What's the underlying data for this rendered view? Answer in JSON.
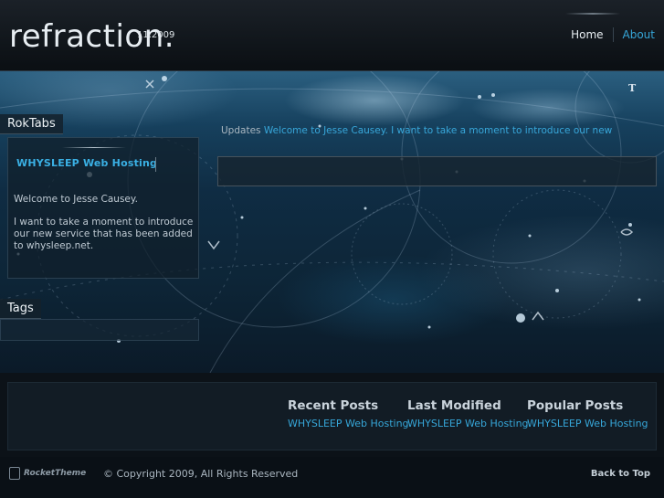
{
  "header": {
    "logo": "refraction.",
    "date": "11.2009",
    "nav": {
      "home": "Home",
      "about": "About"
    }
  },
  "sidebar": {
    "roktabs_title": "RokTabs",
    "tab_label": "WHYSLEEP Web Hosting",
    "para1": "Welcome to Jesse Causey.",
    "para2": "I want to take a moment to introduce our new service that has been added to whysleep.net.",
    "tags_title": "Tags"
  },
  "main": {
    "updates_label": "Updates",
    "updates_text": "Welcome to Jesse Causey. I want to take a moment to introduce our new"
  },
  "bottom": {
    "columns": [
      {
        "heading": "Recent Posts",
        "link": "WHYSLEEP Web Hosting"
      },
      {
        "heading": "Last Modified",
        "link": "WHYSLEEP Web Hosting"
      },
      {
        "heading": "Popular Posts",
        "link": "WHYSLEEP Web Hosting"
      }
    ]
  },
  "footer": {
    "brand": "RocketTheme",
    "copyright": "© Copyright 2009, All Rights Reserved",
    "back_to_top": "Back to Top"
  },
  "colors": {
    "accent": "#36a6d8",
    "background": "#0b121a"
  }
}
